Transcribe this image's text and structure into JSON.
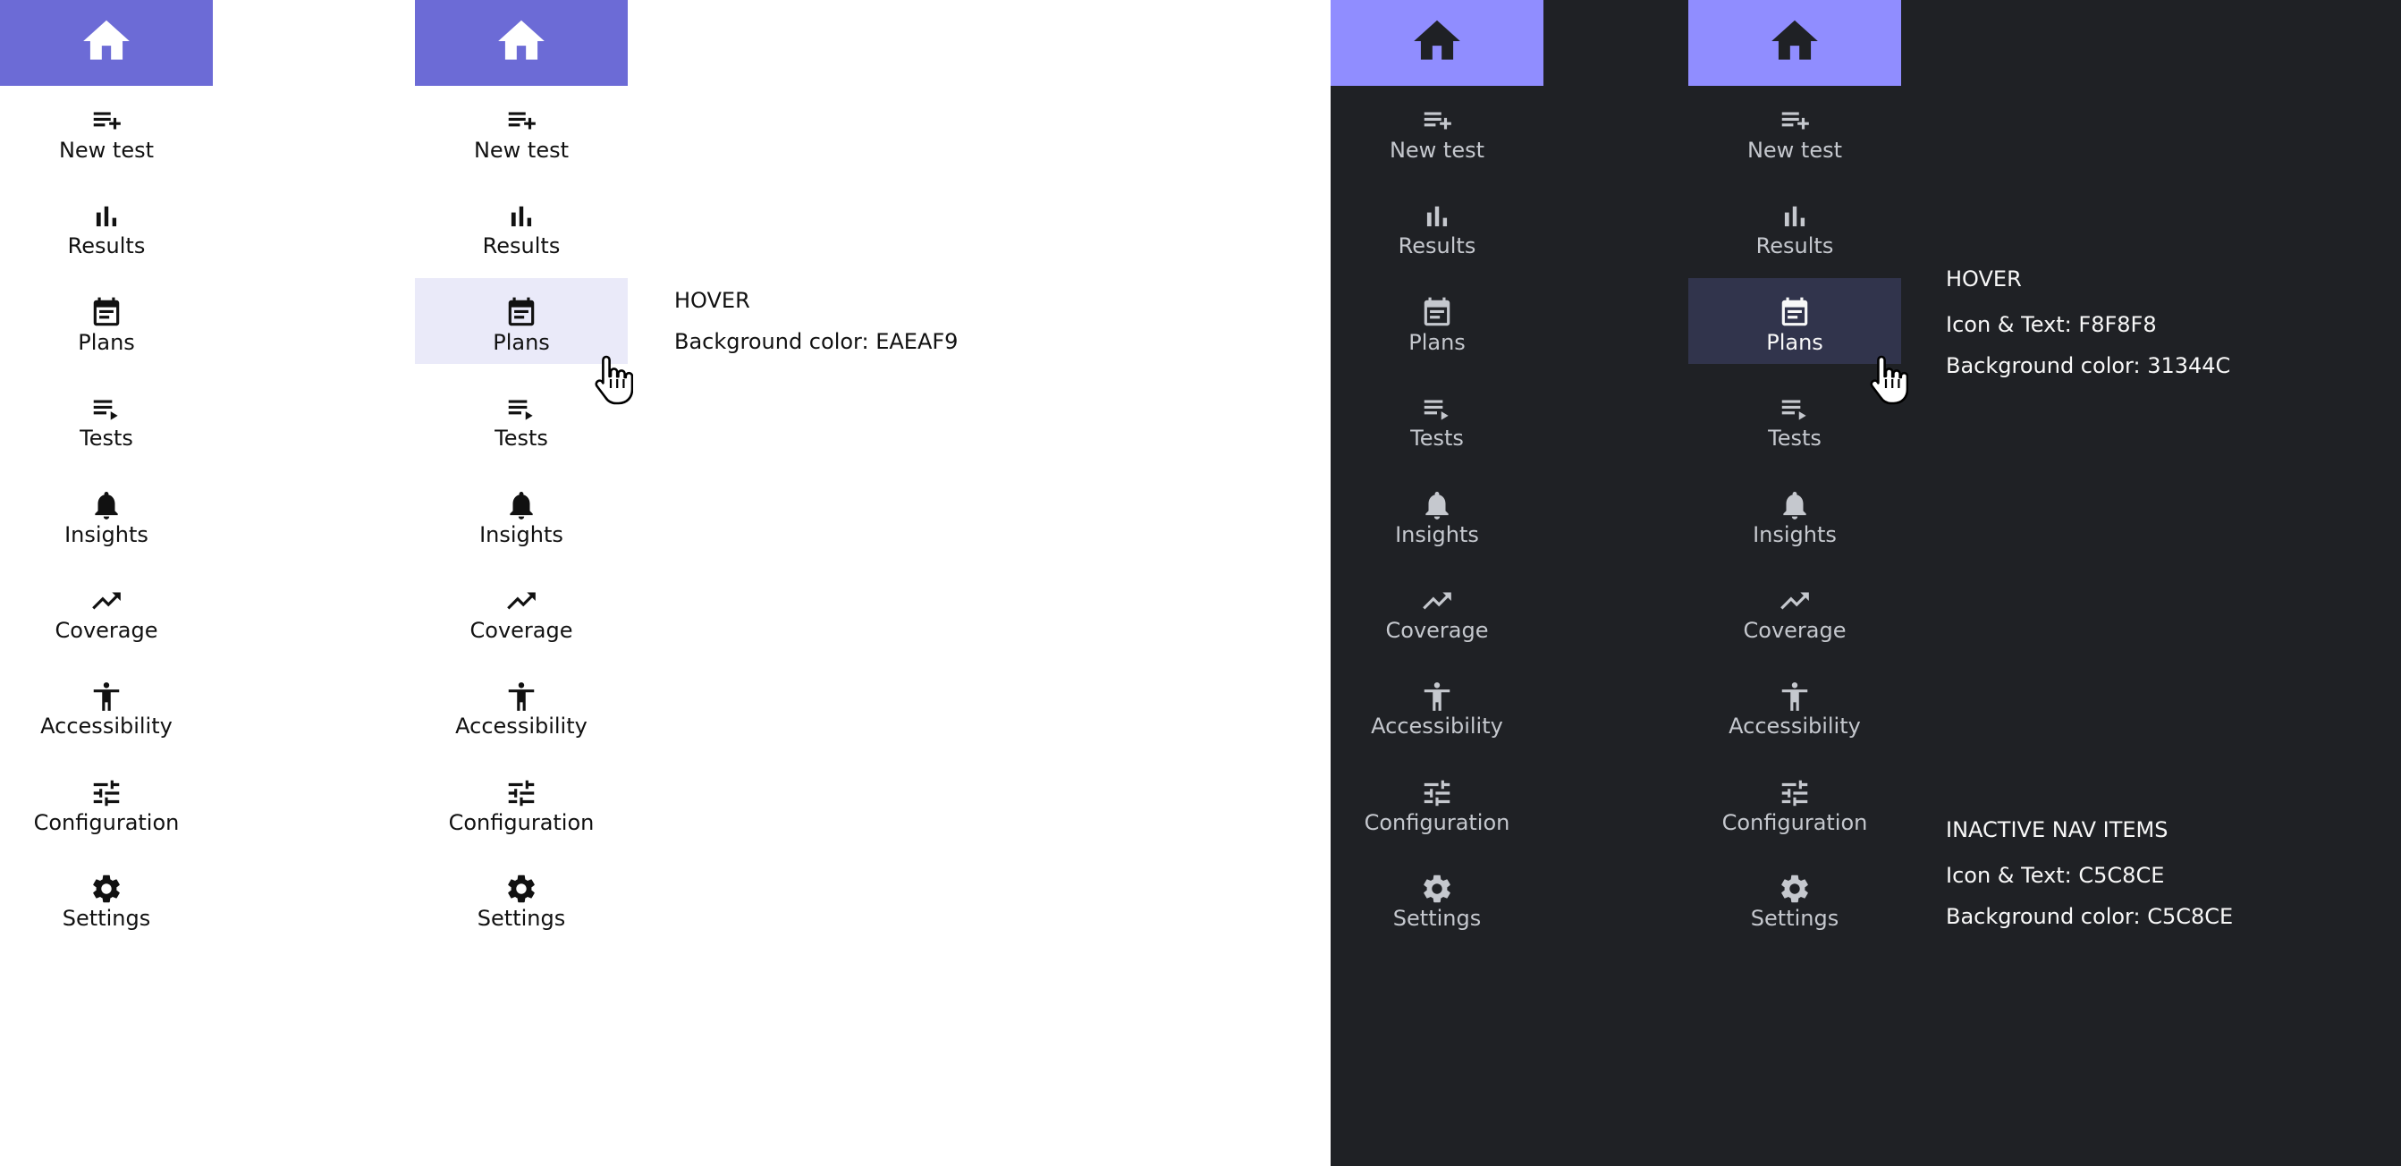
{
  "colors": {
    "light_home_bg": "#6C6BD6",
    "dark_home_bg": "#908DFF",
    "light_hover_bg": "#EAEAF9",
    "dark_hover_bg": "#31344C",
    "dark_panel_bg": "#1F2125",
    "light_text": "#111111",
    "dark_inactive_text": "#C5C8CE",
    "dark_hover_text": "#F8F8F8"
  },
  "nav": {
    "home_icon": "home-icon",
    "items": [
      {
        "key": "new-test",
        "label": "New test",
        "icon": "playlist-add-icon"
      },
      {
        "key": "results",
        "label": "Results",
        "icon": "bar-chart-icon"
      },
      {
        "key": "plans",
        "label": "Plans",
        "icon": "calendar-icon"
      },
      {
        "key": "tests",
        "label": "Tests",
        "icon": "playlist-play-icon"
      },
      {
        "key": "insights",
        "label": "Insights",
        "icon": "bell-icon"
      },
      {
        "key": "coverage",
        "label": "Coverage",
        "icon": "trending-up-icon"
      },
      {
        "key": "accessibility",
        "label": "Accessibility",
        "icon": "accessibility-icon"
      },
      {
        "key": "configuration",
        "label": "Configuration",
        "icon": "tune-icon"
      },
      {
        "key": "settings",
        "label": "Settings",
        "icon": "gear-icon"
      }
    ]
  },
  "notes": {
    "light_hover": {
      "heading": "HOVER",
      "bg": "Background color: EAEAF9"
    },
    "dark_hover": {
      "heading": "HOVER",
      "icon_text": "Icon & Text: F8F8F8",
      "bg": "Background color:  31344C"
    },
    "dark_inactive": {
      "heading": "INACTIVE NAV ITEMS",
      "icon_text": "Icon & Text: C5C8CE",
      "bg": "Background color:  C5C8CE"
    }
  }
}
